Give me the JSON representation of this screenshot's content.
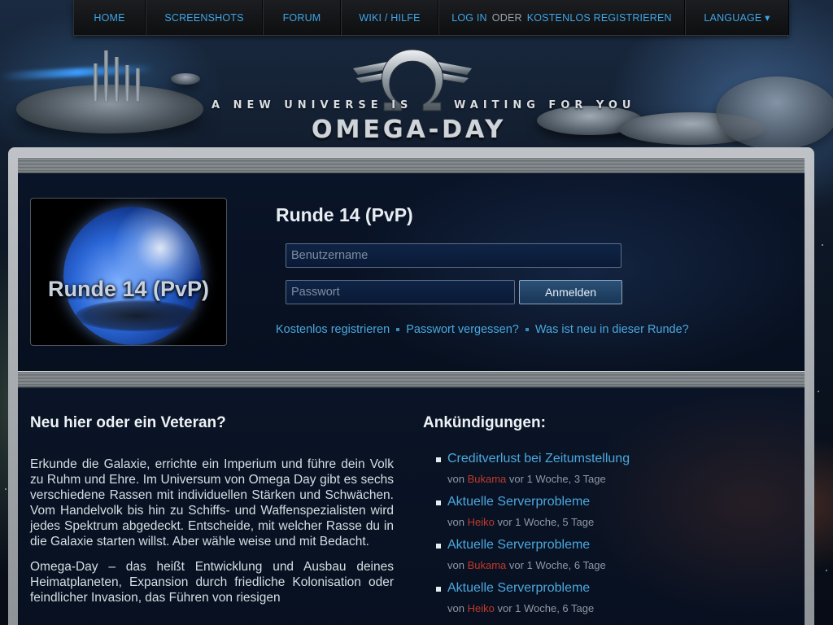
{
  "nav": {
    "home": "HOME",
    "screenshots": "SCREENSHOTS",
    "forum": "FORUM",
    "wiki": "WIKI / HILFE",
    "login": "LOG IN",
    "oder": "ODER",
    "register": "KOSTENLOS REGISTRIEREN",
    "language": "LANGUAGE ▾"
  },
  "header": {
    "tagline_left": "A NEW UNIVERSE IS",
    "tagline_right": "WAITING FOR YOU",
    "brand": "OMEGA-DAY",
    "logo_icon": "omega-winged-icon"
  },
  "login": {
    "round_image_caption": "Runde 14 (PvP)",
    "round_title": "Runde 14 (PvP)",
    "username_placeholder": "Benutzername",
    "password_placeholder": "Passwort",
    "submit_label": "Anmelden",
    "links": {
      "register": "Kostenlos registrieren",
      "forgot": "Passwort vergessen?",
      "whatsnew": "Was ist neu in dieser Runde?"
    }
  },
  "intro": {
    "heading": "Neu hier oder ein Veteran?",
    "paragraph1": "Erkunde die Galaxie, errichte ein Imperium und führe dein Volk zu Ruhm und Ehre. Im Universum von Omega Day gibt es sechs verschiedene Rassen mit individuellen Stärken und Schwächen. Vom Handelvolk bis hin zu Schiffs- und Waffenspezialisten wird jedes Spektrum abgedeckt. Entscheide, mit welcher Rasse du in die Galaxie starten willst. Aber wähle weise und mit Bedacht.",
    "paragraph2": "Omega-Day – das heißt Entwicklung und Ausbau deines Heimatplaneten, Expansion durch friedliche Kolonisation oder feindlicher Invasion, das Führen von riesigen"
  },
  "announcements": {
    "heading": "Ankündigungen:",
    "items": [
      {
        "title": "Creditverlust bei Zeitumstellung",
        "by": "von",
        "author": "Bukama",
        "time": "vor 1 Woche, 3 Tage"
      },
      {
        "title": "Aktuelle Serverprobleme",
        "by": "von",
        "author": "Heiko",
        "time": "vor 1 Woche, 5 Tage"
      },
      {
        "title": "Aktuelle Serverprobleme",
        "by": "von",
        "author": "Bukama",
        "time": "vor 1 Woche, 6 Tage"
      },
      {
        "title": "Aktuelle Serverprobleme",
        "by": "von",
        "author": "Heiko",
        "time": "vor 1 Woche, 6 Tage"
      }
    ]
  },
  "colors": {
    "link": "#4aa8de",
    "author": "#c0392b",
    "nav_text": "#3ea6e8"
  }
}
